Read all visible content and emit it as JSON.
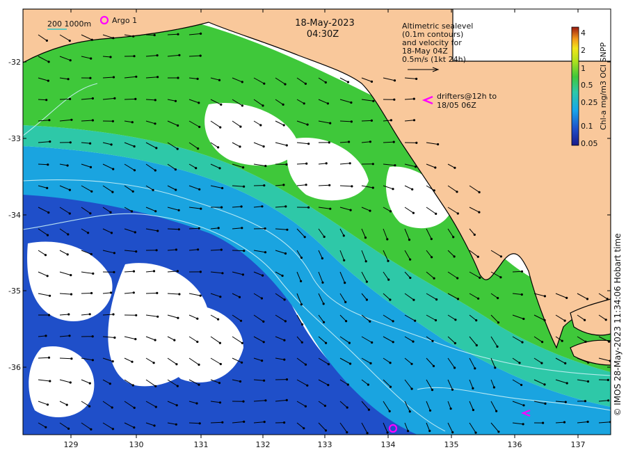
{
  "map": {
    "title_date": "18-May-2023",
    "title_time": "04:30Z",
    "scale_label": "200  1000m",
    "argo_label": "Argo 1",
    "altimetry_text": [
      "Altimetric sealevel",
      "(0.1m contours)",
      "and velocity for",
      "18-May 04Z",
      "0.5m/s (1kt 24h)"
    ],
    "drifters_text": [
      "drifters@12h to",
      "18/05 06Z"
    ],
    "credit": "© IMOS 28-May-2023 11:34:06 Hobart time",
    "x_ticks": [
      "129",
      "130",
      "131",
      "132",
      "133",
      "134",
      "135",
      "136",
      "137"
    ],
    "y_ticks": [
      "-32",
      "-33",
      "-34",
      "-35",
      "-36"
    ],
    "colorbar": {
      "title": "Chl-a mg/m3 OCI SNPP",
      "ticks": [
        "4",
        "2",
        "1",
        "0.5",
        "0.25",
        "0.1",
        "0.05"
      ]
    },
    "colors": {
      "land": "#f9c89b",
      "low_chl": "#1f4fc9",
      "mid_chl": "#1aa4e0",
      "high_chl": "#3fc83a",
      "drifter_marker": "#ff00ff"
    }
  }
}
